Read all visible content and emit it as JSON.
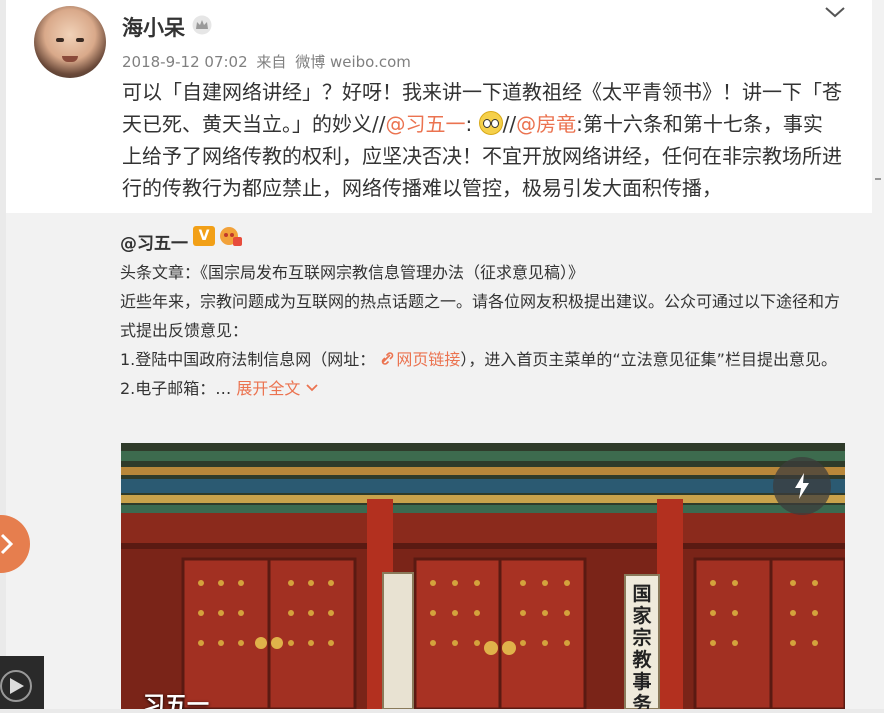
{
  "post": {
    "author": "海小呆",
    "meta": {
      "date": "2018-9-12 07:02",
      "from_label": "来自",
      "source": "微博 weibo.com"
    },
    "text": {
      "p1": "可以「自建网络讲经」？好呀！我来讲一下道教祖经《太平青领书》！讲一下「苍天已死、黄天当立。」的妙义//",
      "mention1": "@习五一",
      "colon1": ":",
      "sep": "//",
      "mention2": "@房竜",
      "p2": ":第十六条和第十七条，事实上给予了网络传教的权利，应坚决否决！不宜开放网络讲经，任何在非宗教场所进行的传教行为都应禁止，网络传播难以管控，极易引发大面积传播，"
    },
    "icons": {
      "crown": "crown-icon",
      "chevron": "chevron-down-icon",
      "emoji": "wonder-emoji-icon"
    }
  },
  "repost": {
    "author": "@习五一",
    "v_badge": "V",
    "headline": "头条文章：《国宗局发布互联网宗教信息管理办法（征求意见稿）》",
    "intro": "近些年来，宗教问题成为互联网的热点话题之一。请各位网友积极提出建议。公众可通过以下途径和方式提出反馈意见：",
    "item1_before": "1.登陆中国政府法制信息网（网址：",
    "item1_link": "网页链接",
    "item1_after": "），进入首页主菜单的“立法意见征集”栏目提出意见。",
    "item2": "2.电子邮箱：…",
    "expand_label": "展开全文",
    "photo_caption": "习五一",
    "photo_sign_right": "国家宗教事务局"
  },
  "colors": {
    "accent": "#eb7350",
    "repost_bg": "#f2f2f2",
    "side_button": "#e67e4e"
  }
}
